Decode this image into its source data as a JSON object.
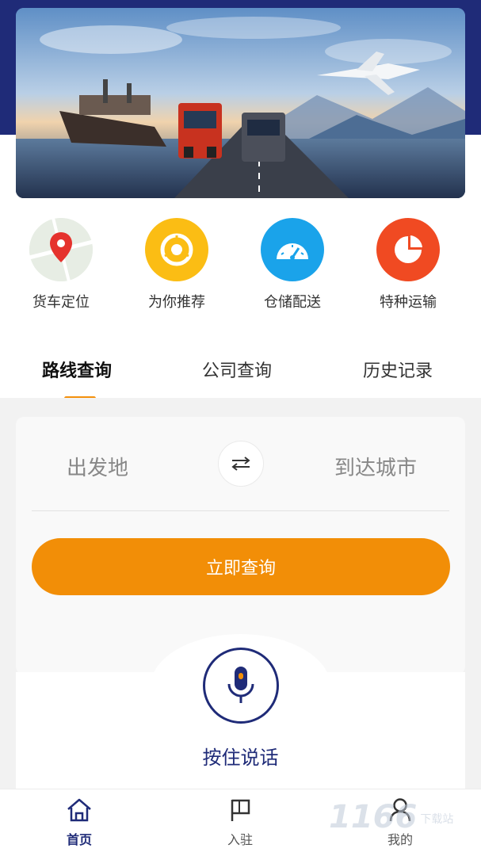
{
  "quick_actions": [
    {
      "label": "货车定位",
      "icon": "map-pin-icon",
      "color": "#e8efe6"
    },
    {
      "label": "为你推荐",
      "icon": "chrome-icon",
      "color": "#fbbd14"
    },
    {
      "label": "仓储配送",
      "icon": "speedometer-icon",
      "color": "#1aa3ea"
    },
    {
      "label": "特种运输",
      "icon": "pie-chart-icon",
      "color": "#f04a22"
    }
  ],
  "tabs": [
    {
      "label": "路线查询",
      "active": true
    },
    {
      "label": "公司查询",
      "active": false
    },
    {
      "label": "历史记录",
      "active": false
    }
  ],
  "search": {
    "origin_placeholder": "出发地",
    "destination_placeholder": "到达城市",
    "query_button": "立即查询"
  },
  "voice": {
    "label": "按住说话"
  },
  "bottom_nav": [
    {
      "label": "首页",
      "icon": "home-icon",
      "active": true
    },
    {
      "label": "入驻",
      "icon": "flag-icon",
      "active": false
    },
    {
      "label": "我的",
      "icon": "user-icon",
      "active": false
    }
  ],
  "watermark": {
    "text": "1166",
    "suffix": "下载站"
  },
  "colors": {
    "brand_navy": "#1f2b78",
    "accent_orange": "#f28e07"
  }
}
